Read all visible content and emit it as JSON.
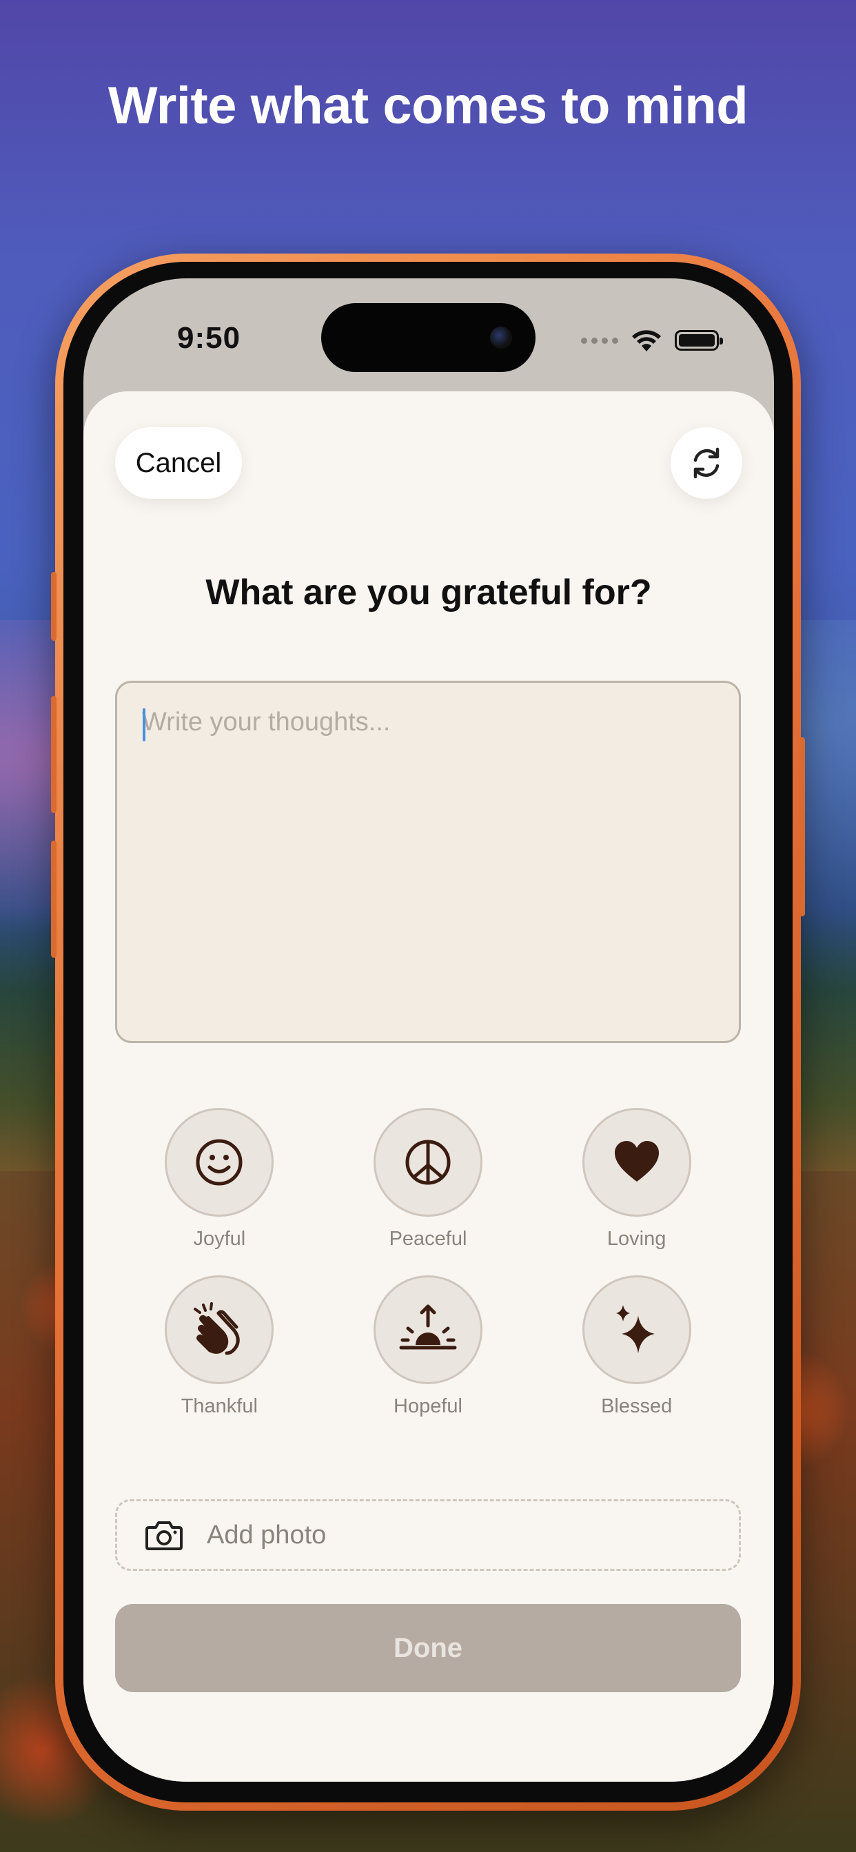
{
  "headline": "Write what comes to mind",
  "status_bar": {
    "time": "9:50",
    "icons": [
      "cellular-dots-icon",
      "wifi-icon",
      "battery-icon"
    ]
  },
  "sheet": {
    "cancel_label": "Cancel",
    "refresh_icon": "refresh-icon",
    "prompt": "What are you grateful for?",
    "thoughts_placeholder": "Write your thoughts...",
    "thoughts_value": "",
    "moods": [
      {
        "label": "Joyful",
        "icon": "smiley-icon"
      },
      {
        "label": "Peaceful",
        "icon": "peace-icon"
      },
      {
        "label": "Loving",
        "icon": "heart-icon"
      },
      {
        "label": "Thankful",
        "icon": "clapping-hands-icon"
      },
      {
        "label": "Hopeful",
        "icon": "sunrise-icon"
      },
      {
        "label": "Blessed",
        "icon": "sparkles-icon"
      }
    ],
    "add_photo_label": "Add photo",
    "done_label": "Done"
  },
  "colors": {
    "icon": "#3a1c10",
    "sheet_bg": "#f9f6f1",
    "done_bg": "#b5aba3",
    "phone_frame": "#e8743a"
  }
}
